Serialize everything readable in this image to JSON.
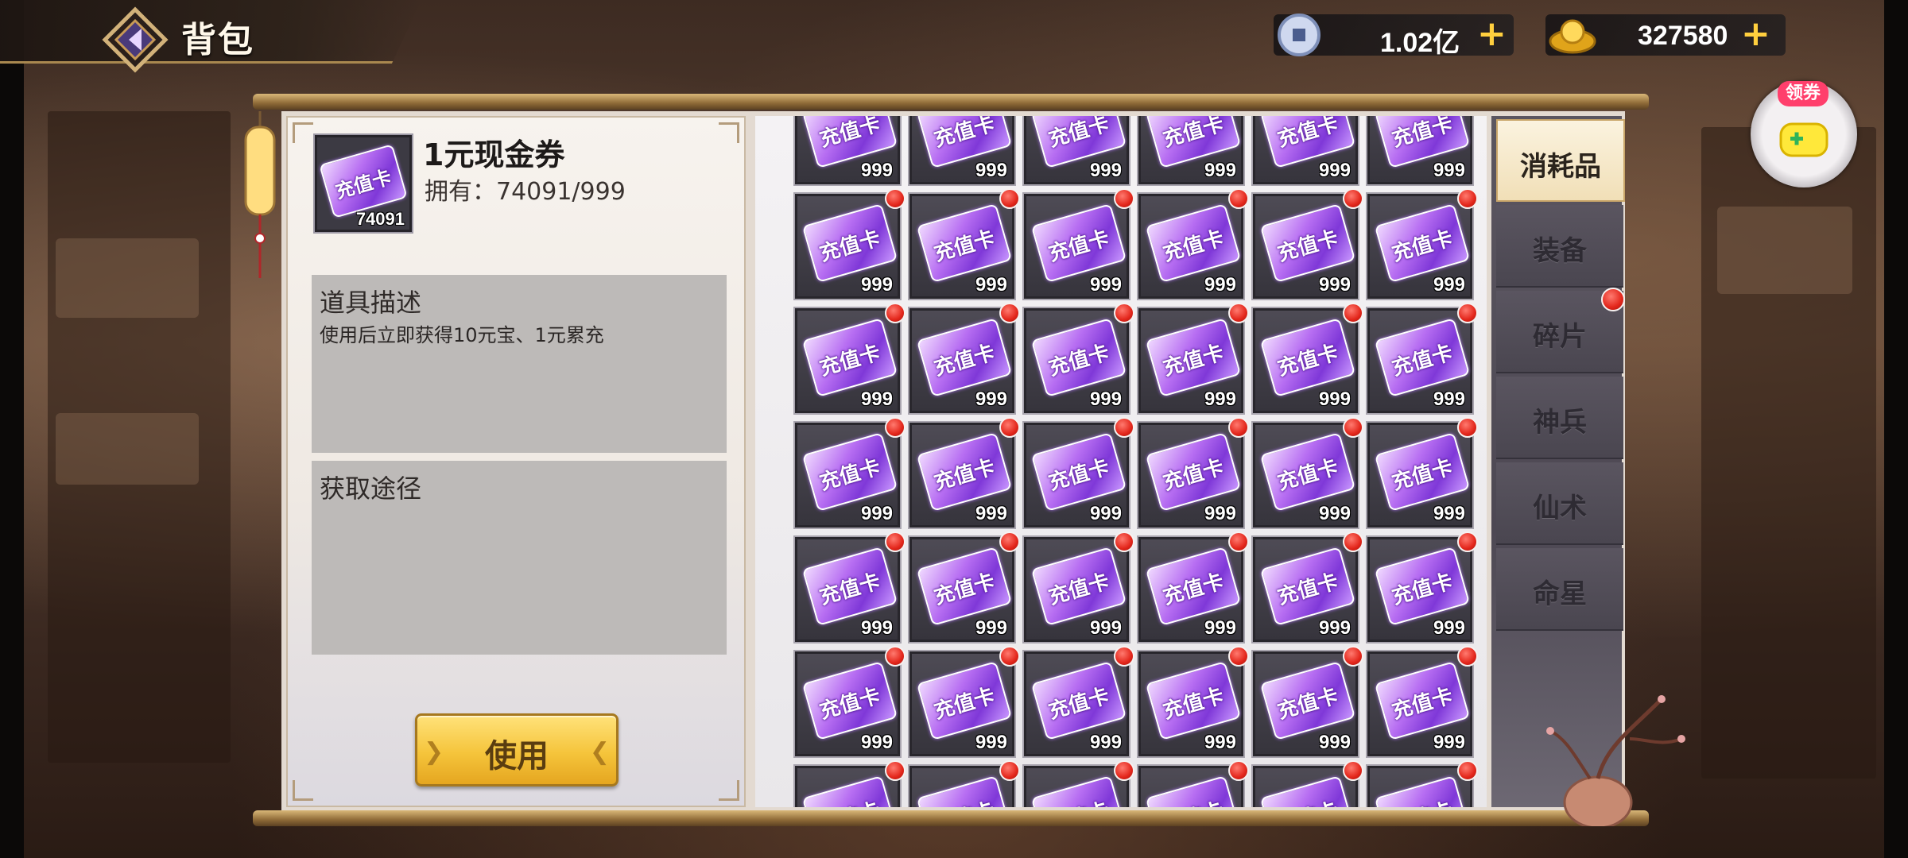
{
  "header": {
    "title": "背包",
    "silver": {
      "value": "1.02亿",
      "plus": "+",
      "icon": "coin-icon"
    },
    "gold": {
      "value": "327580",
      "plus": "+",
      "icon": "gold-ingot-icon"
    },
    "coupon_badge": "领券"
  },
  "item": {
    "name": "1元现金券",
    "owned": "拥有：74091/999",
    "icon_count": "74091",
    "card_text": "充值卡",
    "description_title": "道具描述",
    "description_text": "使用后立即获得10元宝、1元累充",
    "source_title": "获取途径",
    "use_button": "使用"
  },
  "grid": {
    "card_text": "充值卡",
    "quantity": "999"
  },
  "tabs": [
    {
      "label": "消耗品",
      "active": true
    },
    {
      "label": "装备",
      "active": false
    },
    {
      "label": "碎片",
      "active": false
    },
    {
      "label": "神兵",
      "active": false
    },
    {
      "label": "仙术",
      "active": false
    },
    {
      "label": "命星",
      "active": false
    }
  ],
  "colors": {
    "accent_gold": "#f5c43b",
    "badge_red": "#e3261b",
    "card_purple": "#7f38d8"
  }
}
